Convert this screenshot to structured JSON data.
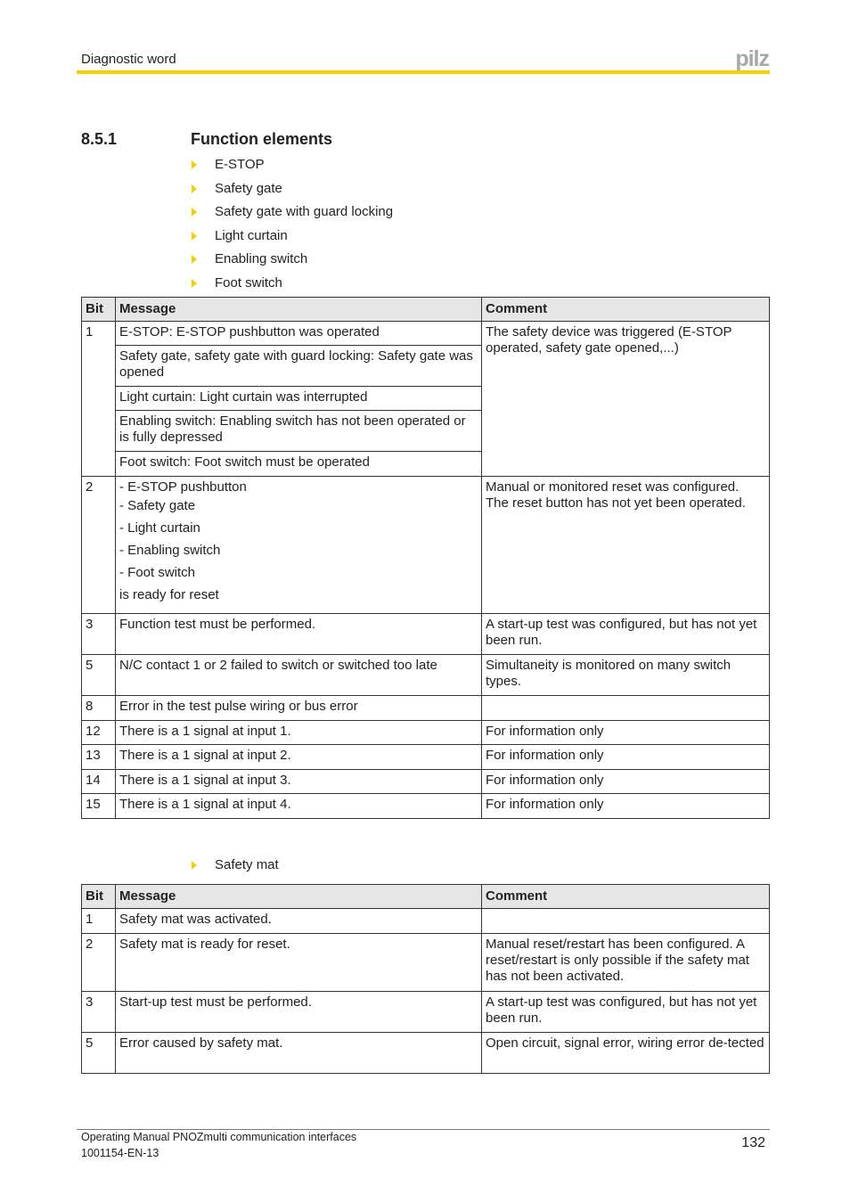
{
  "header": {
    "title": "Diagnostic word",
    "logo": "pilz",
    "accent_color": "#f4d000"
  },
  "section": {
    "number": "8.5.1",
    "title": "Function elements"
  },
  "bullets_1": [
    "E-STOP",
    "Safety gate",
    "Safety gate with guard locking",
    "Light curtain",
    "Enabling switch",
    "Foot switch"
  ],
  "table_1": {
    "headers": [
      "Bit",
      "Message",
      "Comment"
    ],
    "rows": [
      {
        "bit": "1",
        "messages": [
          "E-STOP: E-STOP pushbutton was operated",
          "Safety gate, safety gate with guard locking: Safety gate was opened",
          "Light curtain: Light curtain was interrupted",
          "Enabling switch: Enabling switch has not been operated or is fully depressed",
          "Foot switch: Foot switch must be operated"
        ],
        "comment": "The safety device was triggered (E-STOP operated, safety gate opened,...)"
      },
      {
        "bit": "2",
        "message_lines": [
          "- E-STOP pushbutton",
          "- Safety gate",
          "- Light curtain",
          "- Enabling switch",
          "- Foot switch",
          "is ready for reset"
        ],
        "comment": "Manual or monitored reset was configured. The reset button has not yet been operated."
      },
      {
        "bit": "3",
        "message": "Function test must be performed.",
        "comment": "A start-up test was configured, but has not yet been run."
      },
      {
        "bit": "5",
        "message": "N/C contact 1 or 2 failed to switch or switched too late",
        "comment": "Simultaneity is monitored on many switch types."
      },
      {
        "bit": "8",
        "message": "Error in the test pulse wiring or bus error",
        "comment": ""
      },
      {
        "bit": "12",
        "message": "There is a 1 signal at input 1.",
        "comment": "For information only"
      },
      {
        "bit": "13",
        "message": "There is a 1 signal at input 2.",
        "comment": "For information only"
      },
      {
        "bit": "14",
        "message": "There is a 1 signal at input 3.",
        "comment": "For information only"
      },
      {
        "bit": "15",
        "message": "There is a 1 signal at input 4.",
        "comment": "For information only"
      }
    ]
  },
  "bullets_2": [
    "Safety mat"
  ],
  "table_2": {
    "headers": [
      "Bit",
      "Message",
      "Comment"
    ],
    "rows": [
      {
        "bit": "1",
        "message": "Safety mat was activated.",
        "comment": ""
      },
      {
        "bit": "2",
        "message": "Safety mat is ready for reset.",
        "comment": "Manual reset/restart has been configured. A reset/restart is only possible if the safety mat has not been activated."
      },
      {
        "bit": "3",
        "message": "Start-up test must be performed.",
        "comment": "A start-up test was configured, but has not yet been run."
      },
      {
        "bit": "5",
        "message": "Error caused by safety mat.",
        "comment": "Open circuit, signal error, wiring error de-tected"
      }
    ]
  },
  "footer": {
    "manual_title": "Operating Manual PNOZmulti communication interfaces",
    "doc_number": "1001154-EN-13",
    "page_number": "132"
  }
}
